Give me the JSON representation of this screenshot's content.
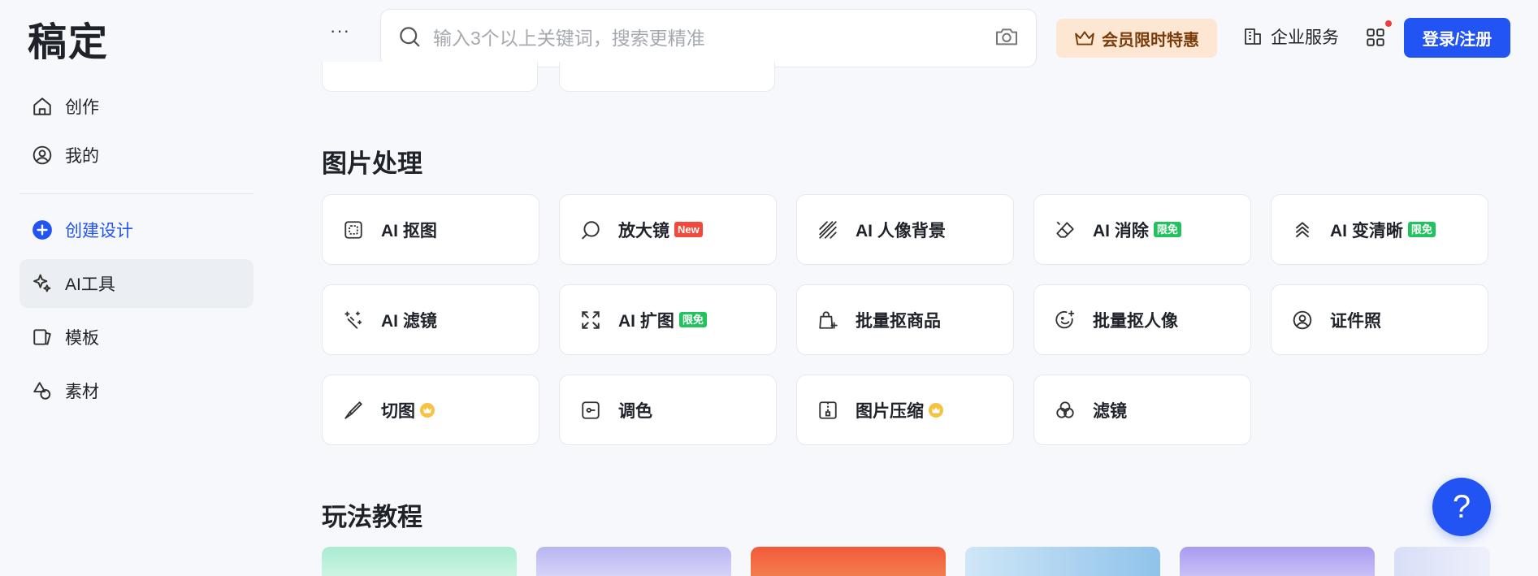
{
  "sidebar": {
    "logo": "稿定",
    "items": [
      {
        "label": "创作",
        "icon": "home-icon"
      },
      {
        "label": "我的",
        "icon": "user-circle-icon"
      },
      {
        "label": "创建设计",
        "icon": "plus-circle-icon"
      },
      {
        "label": "AI工具",
        "icon": "ai-sparkle-icon"
      },
      {
        "label": "模板",
        "icon": "template-icon"
      },
      {
        "label": "素材",
        "icon": "shapes-icon"
      }
    ]
  },
  "header": {
    "more": "···",
    "search_placeholder": "输入3个以上关键词，搜索更精准",
    "vip_label": "会员限时特惠",
    "enterprise_label": "企业服务",
    "login_label": "登录/注册"
  },
  "main": {
    "image_section_title": "图片处理",
    "tools": [
      {
        "label": "AI 抠图",
        "icon": "select-icon",
        "badge": ""
      },
      {
        "label": "放大镜",
        "icon": "magnifier-icon",
        "badge": "New"
      },
      {
        "label": "AI 人像背景",
        "icon": "portrait-bg-icon",
        "badge": ""
      },
      {
        "label": "AI 消除",
        "icon": "eraser-icon",
        "badge": "限免"
      },
      {
        "label": "AI 变清晰",
        "icon": "sharpen-icon",
        "badge": "限免"
      },
      {
        "label": "AI 滤镜",
        "icon": "magic-wand-icon",
        "badge": ""
      },
      {
        "label": "AI 扩图",
        "icon": "expand-icon",
        "badge": "限免"
      },
      {
        "label": "批量抠商品",
        "icon": "shopping-bag-icon",
        "badge": ""
      },
      {
        "label": "批量抠人像",
        "icon": "face-icon",
        "badge": ""
      },
      {
        "label": "证件照",
        "icon": "id-photo-icon",
        "badge": ""
      },
      {
        "label": "切图",
        "icon": "knife-icon",
        "badge": "crown"
      },
      {
        "label": "调色",
        "icon": "color-adjust-icon",
        "badge": ""
      },
      {
        "label": "图片压缩",
        "icon": "compress-icon",
        "badge": "crown"
      },
      {
        "label": "滤镜",
        "icon": "filter-icon",
        "badge": ""
      }
    ],
    "tutorial_section_title": "玩法教程"
  },
  "help_label": "?",
  "colors": {
    "accent": "#2254f4",
    "new_badge": "#f2493c",
    "free_badge": "#22c35e",
    "vip_bg": "#fde7d2"
  }
}
